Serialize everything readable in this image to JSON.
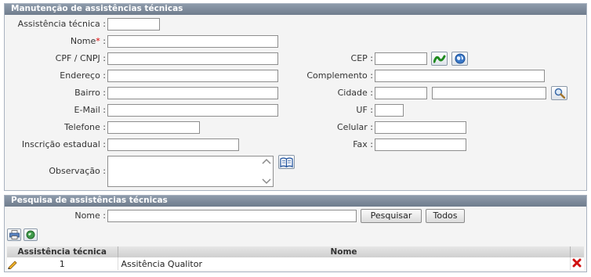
{
  "maintenance": {
    "title": "Manutenção de assistências técnicas",
    "labels": {
      "assistencia": "Assistência técnica :",
      "nome": "Nome",
      "required_mark": "*",
      "colon": " :",
      "cpf": "CPF / CNPJ :",
      "endereco": "Endereço :",
      "bairro": "Bairro :",
      "email": "E-Mail :",
      "telefone": "Telefone :",
      "inscricao": "Inscrição estadual :",
      "observacao": "Observação :",
      "cep": "CEP :",
      "complemento": "Complemento :",
      "cidade": "Cidade :",
      "uf": "UF :",
      "celular": "Celular :",
      "fax": "Fax :"
    },
    "values": {
      "assistencia": "",
      "nome": "",
      "cpf": "",
      "endereco": "",
      "bairro": "",
      "email": "",
      "telefone": "",
      "inscricao": "",
      "observacao": "",
      "cep": "",
      "complemento": "",
      "cidade_codigo": "",
      "cidade_nome": "",
      "uf": "",
      "celular": "",
      "fax": ""
    }
  },
  "search": {
    "title": "Pesquisa de assistências técnicas",
    "nome_label": "Nome :",
    "nome_value": "",
    "search_button": "Pesquisar",
    "all_button": "Todos"
  },
  "table": {
    "columns": [
      "Assistência técnica",
      "Nome"
    ],
    "rows": [
      {
        "codigo": "1",
        "nome": "Assitência Qualitor"
      }
    ]
  },
  "colors": {
    "header": "#7a8797",
    "delete": "#d01010",
    "accent": "#2a7a2a"
  }
}
